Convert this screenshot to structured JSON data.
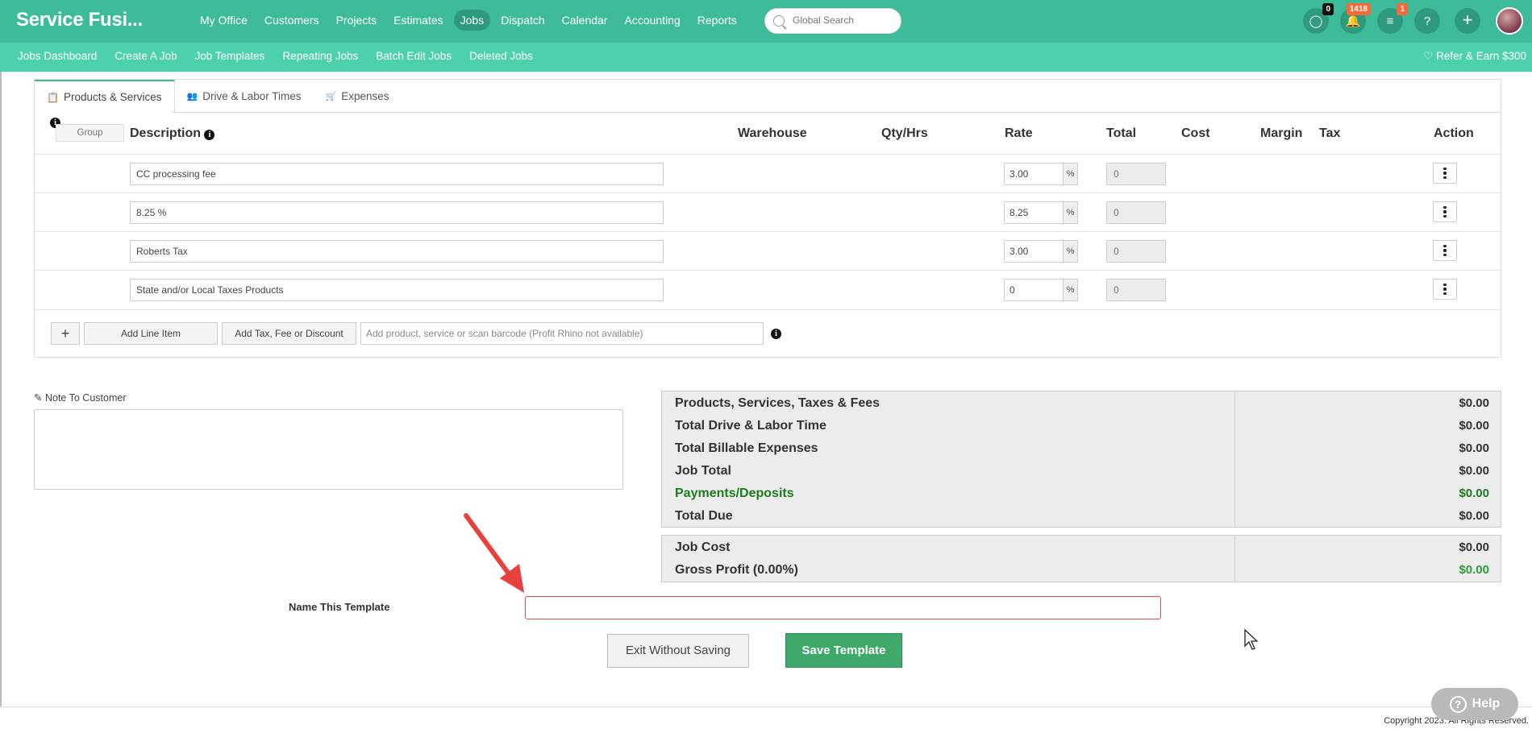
{
  "app": {
    "brand": "Service Fusi..."
  },
  "main_nav": [
    {
      "label": "My Office"
    },
    {
      "label": "Customers"
    },
    {
      "label": "Projects"
    },
    {
      "label": "Estimates"
    },
    {
      "label": "Jobs",
      "active": true
    },
    {
      "label": "Dispatch"
    },
    {
      "label": "Calendar"
    },
    {
      "label": "Accounting"
    },
    {
      "label": "Reports"
    }
  ],
  "search": {
    "placeholder": "Global Search"
  },
  "top_icons": {
    "chat_badge": "0",
    "notifications_badge": "1418",
    "tasks_badge": "1",
    "help_glyph": "?"
  },
  "sub_nav": [
    {
      "label": "Jobs Dashboard"
    },
    {
      "label": "Create A Job"
    },
    {
      "label": "Job Templates"
    },
    {
      "label": "Repeating Jobs"
    },
    {
      "label": "Batch Edit Jobs"
    },
    {
      "label": "Deleted Jobs"
    }
  ],
  "refer": {
    "label": "Refer & Earn $300"
  },
  "tabs": [
    {
      "label": "Products & Services",
      "icon": "clipboard-icon",
      "active": true
    },
    {
      "label": "Drive & Labor Times",
      "icon": "people-icon"
    },
    {
      "label": "Expenses",
      "icon": "cart-icon"
    }
  ],
  "table": {
    "group_label": "Group",
    "headers": {
      "description": "Description",
      "warehouse": "Warehouse",
      "qty": "Qty/Hrs",
      "rate": "Rate",
      "total": "Total",
      "cost": "Cost",
      "margin": "Margin",
      "tax": "Tax",
      "action": "Action"
    },
    "rows": [
      {
        "description": "CC processing fee",
        "rate": "3.00",
        "unit": "%",
        "total": "0"
      },
      {
        "description": "8.25 %",
        "rate": "8.25",
        "unit": "%",
        "total": "0"
      },
      {
        "description": "Roberts Tax",
        "rate": "3.00",
        "unit": "%",
        "total": "0"
      },
      {
        "description": "State and/or Local Taxes Products",
        "rate": "0",
        "unit": "%",
        "total": "0"
      }
    ],
    "add_plus": "+",
    "add_line_item": "Add Line Item",
    "add_tax": "Add Tax, Fee or Discount",
    "barcode_placeholder": "Add product, service or scan barcode (Profit Rhino not available)"
  },
  "note": {
    "label": "Note To Customer",
    "value": ""
  },
  "summary": [
    {
      "label": "Products, Services, Taxes & Fees",
      "value": "$0.00"
    },
    {
      "label": "Total Drive & Labor Time",
      "value": "$0.00"
    },
    {
      "label": "Total Billable Expenses",
      "value": "$0.00"
    },
    {
      "label": "Job Total",
      "value": "$0.00"
    },
    {
      "label": "Payments/Deposits",
      "value": "$0.00",
      "accent": "#1a7d1a"
    },
    {
      "label": "Total Due",
      "value": "$0.00"
    }
  ],
  "profit": [
    {
      "label": "Job Cost",
      "value": "$0.00"
    },
    {
      "label": "Gross Profit (0.00%)",
      "value": "$0.00",
      "accent": "#2e9a3a"
    }
  ],
  "template": {
    "name_label": "Name This Template",
    "name_value": "",
    "exit_label": "Exit Without Saving",
    "save_label": "Save Template"
  },
  "footer": {
    "copyright": "Copyright 2023. All Rights Reserved."
  },
  "help": {
    "label": "Help"
  },
  "colors": {
    "brand": "#3ebb98",
    "subbar": "#4dd0ac",
    "save": "#3ea96b",
    "required_border": "#e14a4a"
  }
}
